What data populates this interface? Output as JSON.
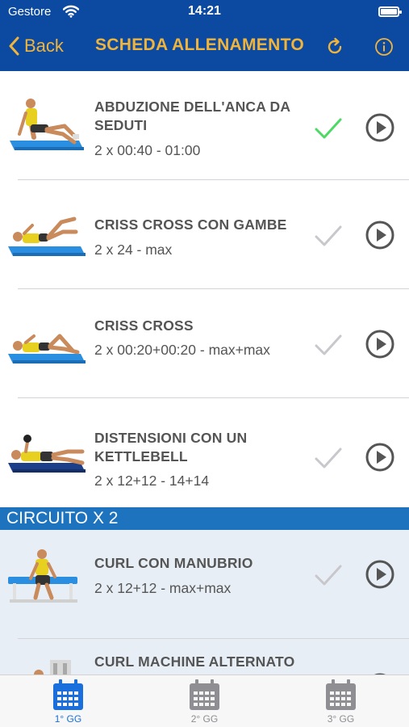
{
  "status": {
    "carrier": "Gestore",
    "time": "14:21"
  },
  "nav": {
    "back_label": "Back",
    "title": "SCHEDA ALLENAMENTO"
  },
  "exercises": [
    {
      "title": "ABDUZIONE DELL'ANCA DA SEDUTI",
      "detail": "2 x 00:40 - 01:00",
      "completed": true
    },
    {
      "title": "CRISS CROSS CON GAMBE",
      "detail": "2 x 24 - max",
      "completed": false
    },
    {
      "title": "CRISS CROSS",
      "detail": "2 x 00:20+00:20 - max+max",
      "completed": false
    },
    {
      "title": "DISTENSIONI CON UN KETTLEBELL",
      "detail": "2 x 12+12 - 14+14",
      "completed": false
    }
  ],
  "section": {
    "title": "CIRCUITO X 2"
  },
  "circuit_exercises": [
    {
      "title": "CURL CON MANUBRIO",
      "detail": "2 x 12+12 - max+max",
      "completed": false
    },
    {
      "title": "CURL MACHINE ALTERNATO",
      "detail": "",
      "completed": false
    }
  ],
  "tabs": [
    {
      "label": "1° GG",
      "active": true
    },
    {
      "label": "2° GG",
      "active": false
    },
    {
      "label": "3° GG",
      "active": false
    }
  ],
  "colors": {
    "nav_bg": "#0b4aa0",
    "nav_text": "#f0b43c",
    "section_bg": "#1e73be",
    "check_done": "#4cd964",
    "check_pending": "#c8c8cc",
    "tab_active": "#1a6fdc"
  }
}
